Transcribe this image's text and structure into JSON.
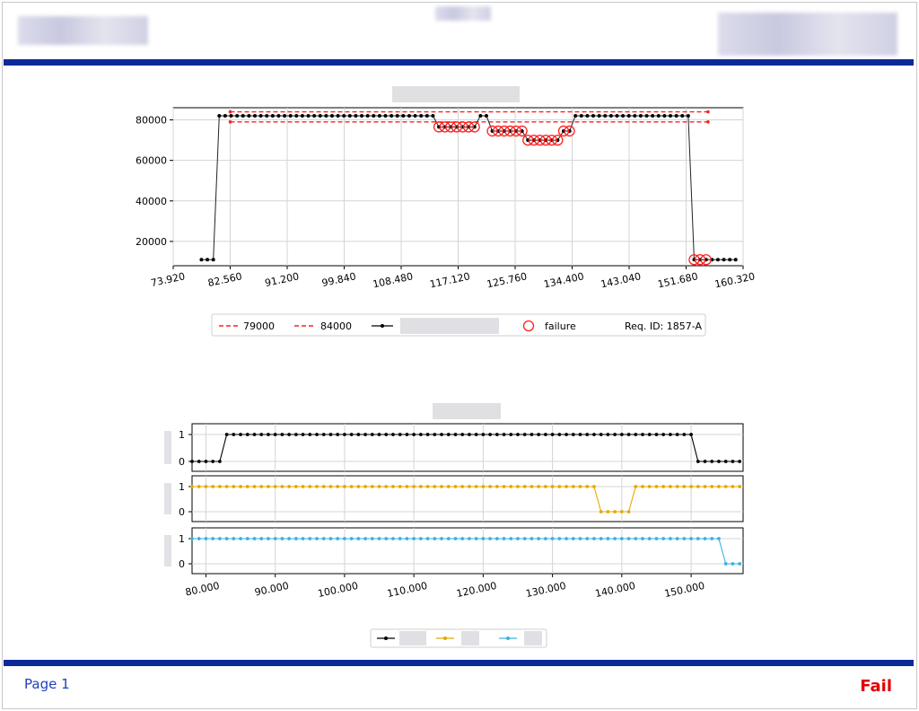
{
  "page": {
    "number_label": "Page 1",
    "status": "Fail",
    "status_color": "#e00000",
    "rule_color": "#0b2a9a"
  },
  "chart_data": [
    {
      "type": "line",
      "title": "",
      "xlim": [
        73.92,
        160.32
      ],
      "ylim": [
        8000,
        86000
      ],
      "xticks": [
        "73.920",
        "82.560",
        "91.200",
        "99.840",
        "108.480",
        "117.120",
        "125.760",
        "134.400",
        "143.040",
        "151.680",
        "160.320"
      ],
      "yticks": [
        20000,
        40000,
        60000,
        80000
      ],
      "grid": true,
      "legend": {
        "placement": "bottom",
        "entries": [
          {
            "label": "79000",
            "style": "red-dashed"
          },
          {
            "label": "84000",
            "style": "red-dashed"
          },
          {
            "label": "",
            "style": "black-line-dot"
          },
          {
            "label": "failure",
            "style": "red-open-circle"
          },
          {
            "label": "Req. ID: 1857-A",
            "style": "none"
          }
        ]
      },
      "thresholds": [
        {
          "name": "79000",
          "value": 79000,
          "x": [
            82.56,
            155.0
          ],
          "color": "#ff2020"
        },
        {
          "name": "84000",
          "value": 84000,
          "x": [
            82.56,
            155.0
          ],
          "color": "#ff2020"
        }
      ],
      "series": [
        {
          "color": "#000000",
          "points": [
            [
              78.2,
              11000
            ],
            [
              79.1,
              11000
            ],
            [
              80.0,
              11000
            ],
            [
              80.9,
              82000
            ],
            [
              81.8,
              82000
            ],
            [
              82.7,
              82000
            ],
            [
              83.6,
              82000
            ],
            [
              84.5,
              82000
            ],
            [
              85.4,
              82000
            ],
            [
              86.3,
              82000
            ],
            [
              87.2,
              82000
            ],
            [
              88.1,
              82000
            ],
            [
              89.0,
              82000
            ],
            [
              89.9,
              82000
            ],
            [
              90.8,
              82000
            ],
            [
              91.7,
              82000
            ],
            [
              92.6,
              82000
            ],
            [
              93.5,
              82000
            ],
            [
              94.4,
              82000
            ],
            [
              95.3,
              82000
            ],
            [
              96.2,
              82000
            ],
            [
              97.1,
              82000
            ],
            [
              98.0,
              82000
            ],
            [
              98.9,
              82000
            ],
            [
              99.8,
              82000
            ],
            [
              100.7,
              82000
            ],
            [
              101.6,
              82000
            ],
            [
              102.5,
              82000
            ],
            [
              103.4,
              82000
            ],
            [
              104.3,
              82000
            ],
            [
              105.2,
              82000
            ],
            [
              106.1,
              82000
            ],
            [
              107.0,
              82000
            ],
            [
              107.9,
              82000
            ],
            [
              108.8,
              82000
            ],
            [
              109.7,
              82000
            ],
            [
              110.6,
              82000
            ],
            [
              111.5,
              82000
            ],
            [
              112.4,
              82000
            ],
            [
              113.3,
              82000
            ],
            [
              114.2,
              76500
            ],
            [
              115.1,
              76500
            ],
            [
              116.0,
              76500
            ],
            [
              116.9,
              76500
            ],
            [
              117.8,
              76500
            ],
            [
              118.7,
              76500
            ],
            [
              119.6,
              76500
            ],
            [
              120.5,
              82000
            ],
            [
              121.4,
              82000
            ],
            [
              122.3,
              74500
            ],
            [
              123.2,
              74500
            ],
            [
              124.1,
              74500
            ],
            [
              125.0,
              74500
            ],
            [
              125.9,
              74500
            ],
            [
              126.8,
              74500
            ],
            [
              127.7,
              70000
            ],
            [
              128.6,
              70000
            ],
            [
              129.5,
              70000
            ],
            [
              130.4,
              70000
            ],
            [
              131.3,
              70000
            ],
            [
              132.2,
              70000
            ],
            [
              133.1,
              74500
            ],
            [
              134.0,
              74500
            ],
            [
              134.9,
              82000
            ],
            [
              135.8,
              82000
            ],
            [
              136.7,
              82000
            ],
            [
              137.6,
              82000
            ],
            [
              138.5,
              82000
            ],
            [
              139.4,
              82000
            ],
            [
              140.3,
              82000
            ],
            [
              141.2,
              82000
            ],
            [
              142.1,
              82000
            ],
            [
              143.0,
              82000
            ],
            [
              143.9,
              82000
            ],
            [
              144.8,
              82000
            ],
            [
              145.7,
              82000
            ],
            [
              146.6,
              82000
            ],
            [
              147.5,
              82000
            ],
            [
              148.4,
              82000
            ],
            [
              149.3,
              82000
            ],
            [
              150.2,
              82000
            ],
            [
              151.1,
              82000
            ],
            [
              152.0,
              82000
            ],
            [
              152.9,
              11000
            ],
            [
              153.8,
              11000
            ],
            [
              154.7,
              11000
            ],
            [
              155.6,
              11000
            ],
            [
              156.5,
              11000
            ],
            [
              157.4,
              11000
            ],
            [
              158.3,
              11000
            ],
            [
              159.2,
              11000
            ]
          ]
        },
        {
          "name": "failure",
          "color": "#ff2020",
          "points": [
            [
              114.2,
              76500
            ],
            [
              115.1,
              76500
            ],
            [
              116.0,
              76500
            ],
            [
              116.9,
              76500
            ],
            [
              117.8,
              76500
            ],
            [
              118.7,
              76500
            ],
            [
              119.6,
              76500
            ],
            [
              122.3,
              74500
            ],
            [
              123.2,
              74500
            ],
            [
              124.1,
              74500
            ],
            [
              125.0,
              74500
            ],
            [
              125.9,
              74500
            ],
            [
              126.8,
              74500
            ],
            [
              127.7,
              70000
            ],
            [
              128.6,
              70000
            ],
            [
              129.5,
              70000
            ],
            [
              130.4,
              70000
            ],
            [
              131.3,
              70000
            ],
            [
              132.2,
              70000
            ],
            [
              133.1,
              74500
            ],
            [
              134.0,
              74500
            ],
            [
              152.9,
              11000
            ],
            [
              153.8,
              11000
            ],
            [
              154.7,
              11000
            ]
          ]
        }
      ]
    },
    {
      "type": "line",
      "title": "",
      "xlim": [
        78.0,
        157.5
      ],
      "xticks": [
        "80.000",
        "90.000",
        "100.000",
        "110.000",
        "120.000",
        "130.000",
        "140.000",
        "150.000"
      ],
      "grid": true,
      "legend": {
        "placement": "bottom",
        "entries": [
          {
            "label": "",
            "color": "#000000"
          },
          {
            "label": "",
            "color": "#e6a800"
          },
          {
            "label": "",
            "color": "#3ab0e0"
          }
        ]
      },
      "panels": [
        {
          "color": "#000000",
          "yticks": [
            0,
            1
          ],
          "x_start": 78.0,
          "step": 1.0,
          "count": 80,
          "segments": [
            [
              0,
              4,
              0
            ],
            [
              5,
              72,
              1
            ],
            [
              73,
              79,
              0
            ]
          ]
        },
        {
          "color": "#e6a800",
          "yticks": [
            0,
            1
          ],
          "x_start": 78.0,
          "step": 1.0,
          "count": 80,
          "segments": [
            [
              0,
              58,
              1
            ],
            [
              59,
              63,
              0
            ],
            [
              64,
              79,
              1
            ]
          ]
        },
        {
          "color": "#3ab0e0",
          "yticks": [
            0,
            1
          ],
          "x_start": 78.0,
          "step": 1.0,
          "count": 80,
          "segments": [
            [
              0,
              76,
              1
            ],
            [
              77,
              79,
              0
            ]
          ]
        }
      ]
    }
  ]
}
